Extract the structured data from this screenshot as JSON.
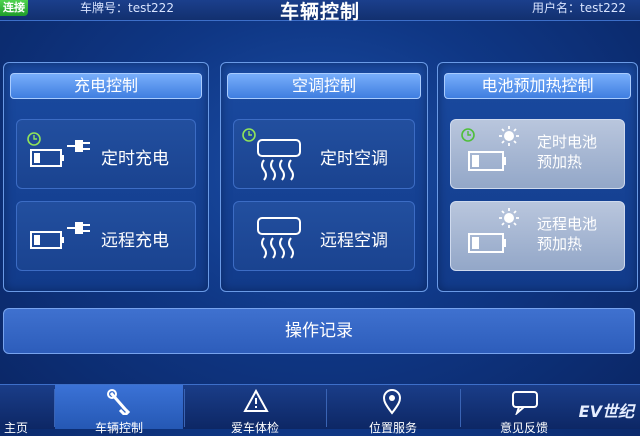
{
  "header": {
    "conn_button": "连接",
    "plate_label": "车牌号：test222",
    "title": "车辆控制",
    "user_label": "用户名：test222"
  },
  "panels": {
    "charge": {
      "title": "充电控制",
      "timed_label": "定时充电",
      "remote_label": "远程充电"
    },
    "ac": {
      "title": "空调控制",
      "timed_label": "定时空调",
      "remote_label": "远程空调"
    },
    "battery": {
      "title": "电池预加热控制",
      "timed_line1": "定时电池",
      "timed_line2": "预加热",
      "remote_line1": "远程电池",
      "remote_line2": "预加热"
    }
  },
  "record_label": "操作记录",
  "nav": {
    "items": [
      {
        "label": "主页"
      },
      {
        "label": "车辆控制"
      },
      {
        "label": "爱车体检"
      },
      {
        "label": "位置服务"
      },
      {
        "label": "意见反馈"
      }
    ]
  },
  "watermark": "EV世纪",
  "colors": {
    "background": "#0f3785",
    "panel_header": "#4f8ceb",
    "tile_dark": "#1e4a98",
    "tile_light": "#a9b8d4",
    "connect_green": "#2fb33a",
    "nav_active": "#2f66c6"
  },
  "icons": [
    "clock-icon",
    "plug-icon",
    "battery-icon",
    "ac-vent-icon",
    "sun-icon",
    "wrench-icon",
    "warning-triangle-icon",
    "location-pin-icon",
    "chat-bubble-icon"
  ]
}
